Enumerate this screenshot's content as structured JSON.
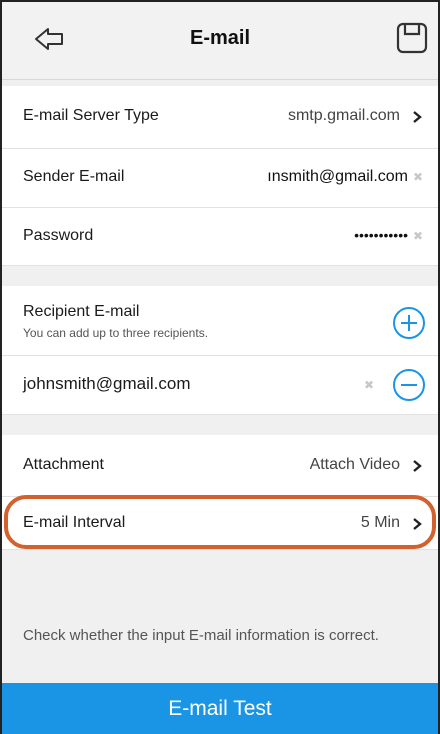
{
  "header": {
    "title": "E-mail",
    "back_icon": "back-arrow-icon",
    "save_icon": "save-icon"
  },
  "server": {
    "label": "E-mail Server Type",
    "value": "smtp.gmail.com"
  },
  "sender": {
    "label": "Sender E-mail",
    "value": "ınsmith@gmail.com"
  },
  "password": {
    "label": "Password",
    "value": "•••••••••••"
  },
  "recipient": {
    "label": "Recipient E-mail",
    "hint": "You can add up to three recipients.",
    "items": [
      "johnsmith@gmail.com"
    ]
  },
  "attachment": {
    "label": "Attachment",
    "value": "Attach Video"
  },
  "interval": {
    "label": "E-mail Interval",
    "value": "5 Min"
  },
  "footer": {
    "hint": "Check whether the input E-mail information is correct.",
    "test_label": "E-mail Test"
  },
  "colors": {
    "accent": "#1a95e6",
    "highlight": "#d2612e"
  }
}
